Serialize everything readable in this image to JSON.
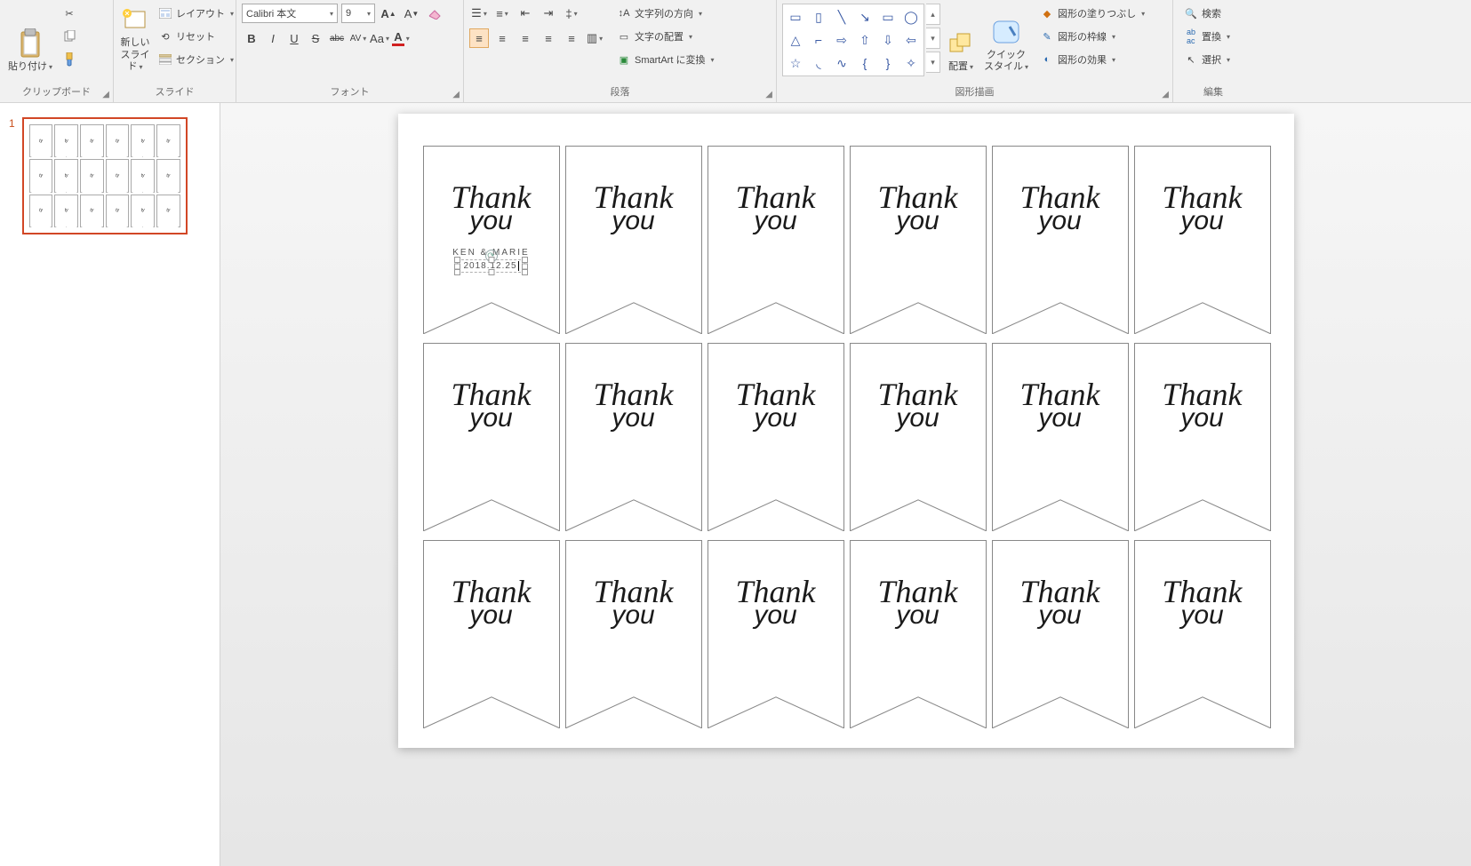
{
  "ribbon": {
    "clipboard": {
      "title": "クリップボード",
      "paste": "貼り付け"
    },
    "slides": {
      "title": "スライド",
      "new_slide": "新しい\nスライド",
      "layout": "レイアウト",
      "reset": "リセット",
      "section": "セクション"
    },
    "font": {
      "title": "フォント",
      "name": "Calibri 本文",
      "size": "9",
      "bold": "B",
      "italic": "I",
      "underline": "U",
      "strike": "S",
      "shadow": "abc",
      "spacing": "AV",
      "case": "Aa"
    },
    "paragraph": {
      "title": "段落",
      "text_direction": "文字列の方向",
      "text_align": "文字の配置",
      "smartart": "SmartArt に変換"
    },
    "drawing": {
      "title": "図形描画",
      "arrange": "配置",
      "quick_style": "クイック\nスタイル",
      "fill": "図形の塗りつぶし",
      "outline": "図形の枠線",
      "effects": "図形の効果"
    },
    "editing": {
      "title": "編集",
      "find": "検索",
      "replace": "置換",
      "select": "選択"
    }
  },
  "thumbnail": {
    "number": "1"
  },
  "slide": {
    "tag_text_1": "Thank",
    "tag_text_2": "you",
    "names": "KEN & MARIE",
    "date": "2018.12.25"
  }
}
